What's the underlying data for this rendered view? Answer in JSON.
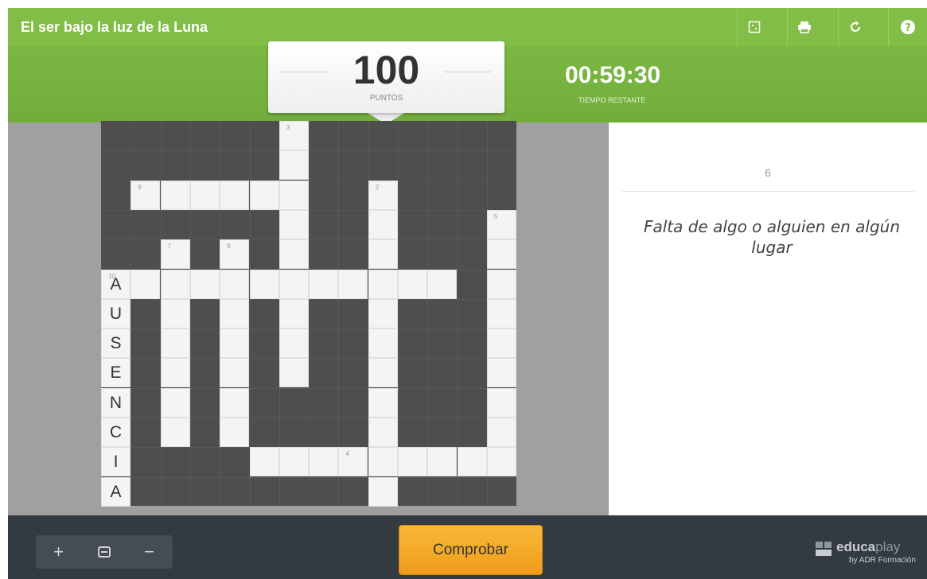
{
  "app": {
    "title": "El ser bajo la luz de la Luna",
    "toolbar": [
      {
        "name": "fullscreen-icon"
      },
      {
        "name": "print-icon"
      },
      {
        "name": "restart-icon"
      },
      {
        "name": "help-icon"
      }
    ]
  },
  "score": {
    "value": "100",
    "label": "PUNTOS"
  },
  "timer": {
    "value": "00:59:30",
    "label": "TIEMPO RESTANTE"
  },
  "crossword": {
    "numbers": [
      "3",
      "9",
      "2",
      "5",
      "7",
      "8",
      "10",
      "4"
    ],
    "letters": [
      "A",
      "U",
      "S",
      "E",
      "N",
      "C",
      "I",
      "A"
    ]
  },
  "clue": {
    "number": "6",
    "text": "Falta de algo o alguien en algún lugar"
  },
  "footer": {
    "zoom_in": "+",
    "zoom_fit_icon": "fit-icon",
    "zoom_out": "−",
    "check_label": "Comprobar",
    "brand_bold": "educa",
    "brand_light": "play",
    "brand_sub": "by ADR Formación"
  },
  "colors": {
    "accent": "#81bd47",
    "check_button": "#f5ad2b",
    "footer": "#333a42",
    "dark_cell": "#4e4e4e"
  }
}
